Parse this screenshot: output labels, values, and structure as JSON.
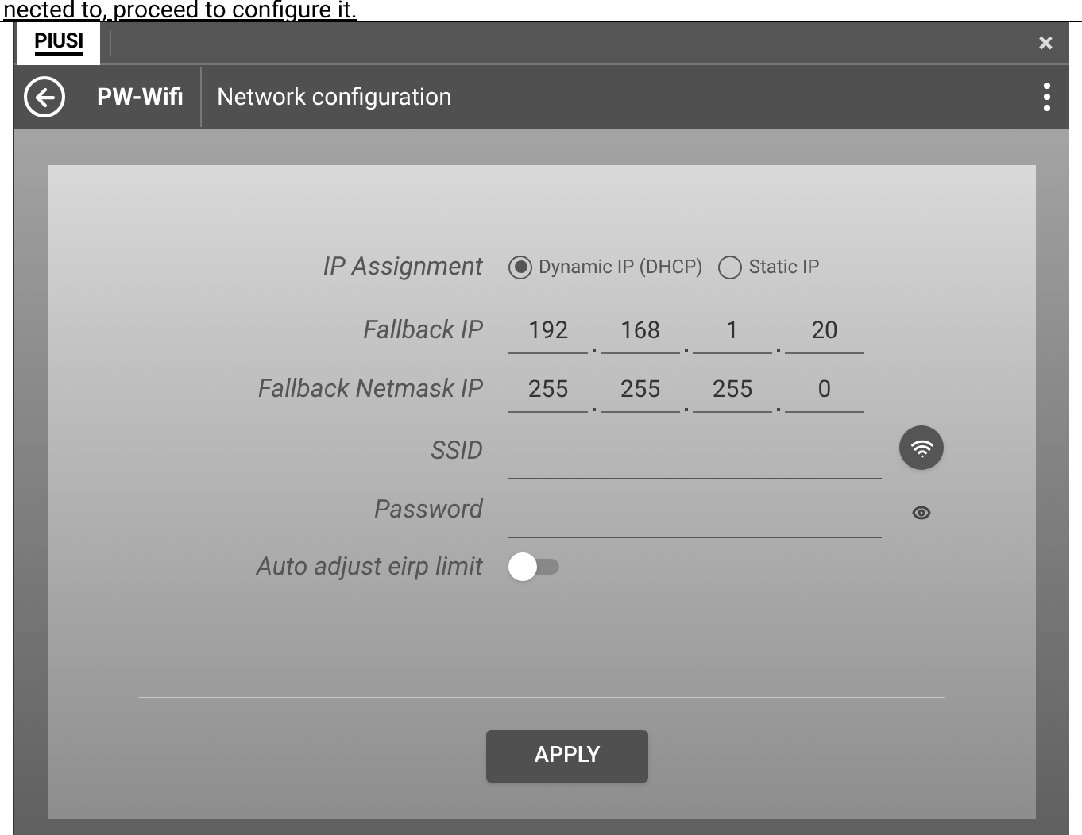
{
  "top_text": "nected to, proceed to configure it.",
  "window": {
    "logo": "PIUSI",
    "close": "×"
  },
  "header": {
    "device": "PW-Wifi",
    "title": "Network configuration"
  },
  "form": {
    "ip_assignment": {
      "label": "IP Assignment",
      "options": [
        {
          "label": "Dynamic IP (DHCP)",
          "selected": true
        },
        {
          "label": "Static IP",
          "selected": false
        }
      ]
    },
    "fallback_ip": {
      "label": "Fallback IP",
      "octets": [
        "192",
        "168",
        "1",
        "20"
      ]
    },
    "netmask": {
      "label": "Fallback Netmask IP",
      "octets": [
        "255",
        "255",
        "255",
        "0"
      ]
    },
    "ssid": {
      "label": "SSID"
    },
    "password": {
      "label": "Password"
    },
    "auto_eirp": {
      "label": "Auto adjust eirp limit",
      "on": false
    }
  },
  "apply": "APPLY"
}
